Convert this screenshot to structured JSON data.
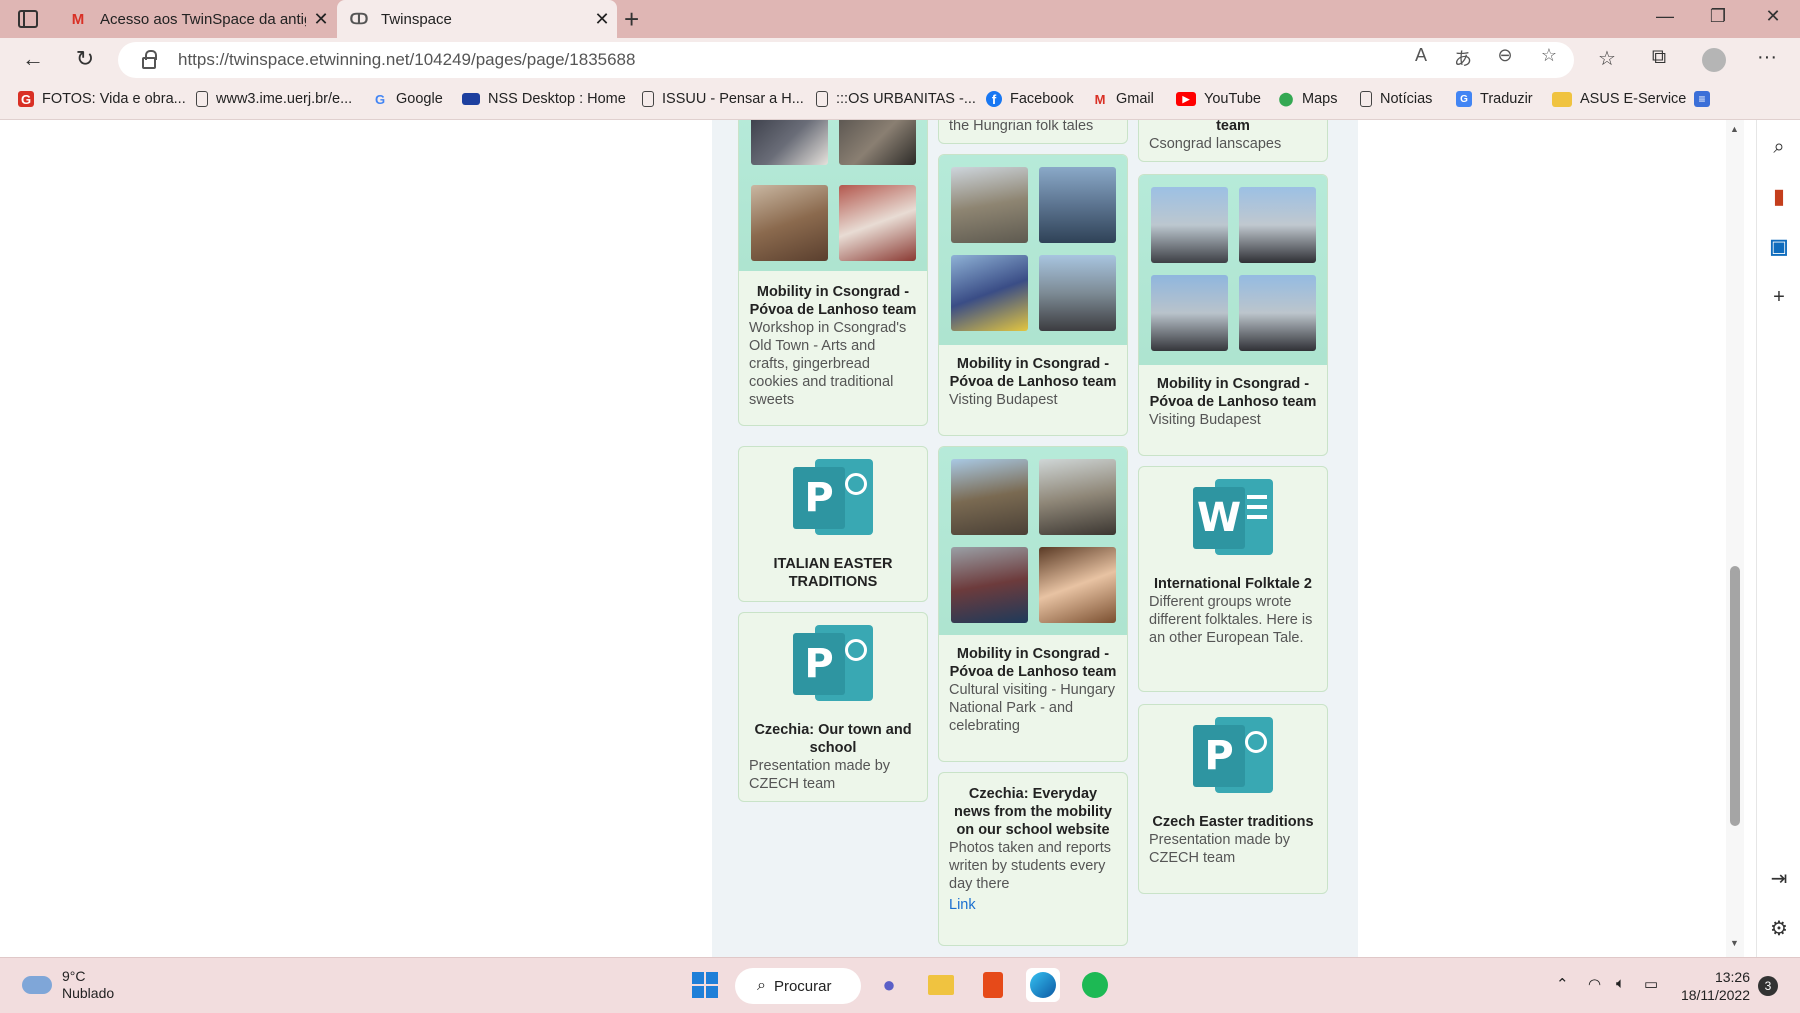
{
  "browser": {
    "tabs": [
      {
        "title": "Acesso aos TwinSpace da antiga",
        "favicon": "gmail-icon"
      },
      {
        "title": "Twinspace",
        "favicon": "twinspace-icon"
      }
    ],
    "url": "https://twinspace.etwinning.net/104249/pages/page/1835688",
    "bookmarks": [
      {
        "label": "FOTOS: Vida e obra...",
        "icon": "G"
      },
      {
        "label": "www3.ime.uerj.br/e...",
        "icon": "doc"
      },
      {
        "label": "Google",
        "icon": "G"
      },
      {
        "label": "NSS Desktop : Home",
        "icon": "eu"
      },
      {
        "label": "ISSUU - Pensar a H...",
        "icon": "doc"
      },
      {
        "label": ":::OS URBANITAS -...",
        "icon": "doc"
      },
      {
        "label": "Facebook",
        "icon": "f"
      },
      {
        "label": "Gmail",
        "icon": "M"
      },
      {
        "label": "YouTube",
        "icon": "yt"
      },
      {
        "label": "Maps",
        "icon": "pin"
      },
      {
        "label": "Notícias",
        "icon": "doc"
      },
      {
        "label": "Traduzir",
        "icon": "tr"
      },
      {
        "label": "ASUS E-Service",
        "icon": "folder"
      }
    ],
    "colors": {
      "accent": "#39a8b3",
      "card_bg": "#edf6ea",
      "photo_bg": "#b6ead9",
      "link": "#1a6fd0"
    }
  },
  "cards": {
    "c1": {
      "title": "Mobility in Csongrad - Póvoa de Lanhoso team",
      "desc": "Workshop in Csongrad's Old Town - Arts and crafts, gingerbread cookies and traditional sweets"
    },
    "c2": {
      "desc_top": "the Hungrian folk tales"
    },
    "c3": {
      "title": "Mobility in Csongrad - Póvoa de Lanhoso team",
      "desc": "Visting Budapest"
    },
    "c4": {
      "title_top": "team",
      "desc_top": "Csongrad lanscapes"
    },
    "c5": {
      "title": "Mobility in Csongrad - Póvoa de Lanhoso team",
      "desc": "Visiting Budapest"
    },
    "c6": {
      "title": "ITALIAN EASTER TRADITIONS"
    },
    "c7": {
      "title": "Mobility in Csongrad - Póvoa de Lanhoso team",
      "desc": "Cultural visiting - Hungary National Park - and celebrating"
    },
    "c8": {
      "title": "International Folktale 2",
      "desc": "Different groups wrote different folktales. Here is an other European Tale."
    },
    "c9": {
      "title": "Czechia: Our town and school",
      "desc": "Presentation made by CZECH team"
    },
    "c10": {
      "title": "Czechia: Everyday news from the mobility on our school website",
      "desc": "Photos taken and reports writen by students every day there",
      "link": "Link"
    },
    "c11": {
      "title": "Czech Easter traditions",
      "desc": "Presentation made by CZECH team"
    }
  },
  "taskbar": {
    "weather_temp": "9°C",
    "weather_desc": "Nublado",
    "search_label": "Procurar",
    "time": "13:26",
    "date": "18/11/2022",
    "notifications": "3"
  }
}
